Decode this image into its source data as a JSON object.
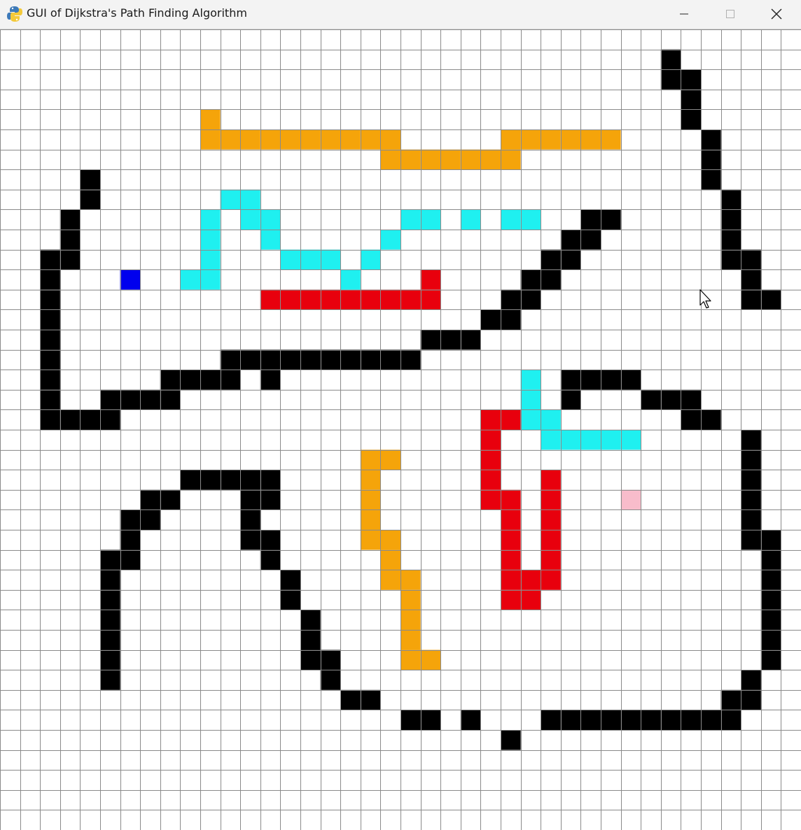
{
  "window": {
    "title": "GUI of Dijkstra's Path Finding Algorithm",
    "icon": "python-icon",
    "controls": [
      "minimize-icon",
      "maximize-icon",
      "close-icon"
    ]
  },
  "grid": {
    "rows": 40,
    "cols": 40,
    "line_color": "#8a8a8a",
    "empty_color": "#ffffff",
    "colors": {
      "barrier": "#000000",
      "start": "#0000ee",
      "end": "#f8bccb",
      "path": "#e8000d",
      "visited": "#f5a40a",
      "frontier": "#1ff0f0"
    },
    "cells": {
      "barrier": [
        [
          33,
          1
        ],
        [
          33,
          2
        ],
        [
          34,
          2
        ],
        [
          34,
          3
        ],
        [
          34,
          4
        ],
        [
          35,
          5
        ],
        [
          35,
          6
        ],
        [
          35,
          7
        ],
        [
          36,
          8
        ],
        [
          36,
          9
        ],
        [
          36,
          10
        ],
        [
          36,
          11
        ],
        [
          37,
          11
        ],
        [
          37,
          12
        ],
        [
          37,
          13
        ],
        [
          38,
          13
        ],
        [
          4,
          7
        ],
        [
          4,
          8
        ],
        [
          3,
          9
        ],
        [
          3,
          10
        ],
        [
          3,
          11
        ],
        [
          2,
          11
        ],
        [
          2,
          12
        ],
        [
          2,
          13
        ],
        [
          2,
          14
        ],
        [
          2,
          15
        ],
        [
          2,
          16
        ],
        [
          2,
          17
        ],
        [
          2,
          18
        ],
        [
          2,
          19
        ],
        [
          3,
          19
        ],
        [
          4,
          19
        ],
        [
          5,
          19
        ],
        [
          5,
          18
        ],
        [
          6,
          18
        ],
        [
          7,
          18
        ],
        [
          8,
          18
        ],
        [
          8,
          17
        ],
        [
          9,
          17
        ],
        [
          10,
          17
        ],
        [
          11,
          17
        ],
        [
          11,
          16
        ],
        [
          12,
          16
        ],
        [
          13,
          17
        ],
        [
          13,
          16
        ],
        [
          14,
          16
        ],
        [
          15,
          16
        ],
        [
          16,
          16
        ],
        [
          17,
          16
        ],
        [
          18,
          16
        ],
        [
          19,
          16
        ],
        [
          20,
          16
        ],
        [
          21,
          15
        ],
        [
          22,
          15
        ],
        [
          23,
          15
        ],
        [
          24,
          14
        ],
        [
          25,
          14
        ],
        [
          25,
          13
        ],
        [
          26,
          13
        ],
        [
          26,
          12
        ],
        [
          27,
          12
        ],
        [
          27,
          11
        ],
        [
          28,
          11
        ],
        [
          28,
          10
        ],
        [
          29,
          10
        ],
        [
          29,
          9
        ],
        [
          30,
          9
        ],
        [
          28,
          17
        ],
        [
          29,
          17
        ],
        [
          30,
          17
        ],
        [
          31,
          17
        ],
        [
          28,
          18
        ],
        [
          32,
          18
        ],
        [
          33,
          18
        ],
        [
          34,
          18
        ],
        [
          34,
          19
        ],
        [
          35,
          19
        ],
        [
          37,
          20
        ],
        [
          37,
          21
        ],
        [
          37,
          22
        ],
        [
          37,
          23
        ],
        [
          37,
          24
        ],
        [
          37,
          25
        ],
        [
          38,
          25
        ],
        [
          38,
          26
        ],
        [
          38,
          27
        ],
        [
          38,
          28
        ],
        [
          38,
          29
        ],
        [
          38,
          30
        ],
        [
          38,
          31
        ],
        [
          37,
          32
        ],
        [
          37,
          33
        ],
        [
          36,
          33
        ],
        [
          36,
          34
        ],
        [
          35,
          34
        ],
        [
          34,
          34
        ],
        [
          33,
          34
        ],
        [
          32,
          34
        ],
        [
          31,
          34
        ],
        [
          30,
          34
        ],
        [
          29,
          34
        ],
        [
          28,
          34
        ],
        [
          27,
          34
        ],
        [
          25,
          35
        ],
        [
          23,
          34
        ],
        [
          21,
          34
        ],
        [
          20,
          34
        ],
        [
          18,
          33
        ],
        [
          17,
          33
        ],
        [
          16,
          32
        ],
        [
          16,
          31
        ],
        [
          15,
          31
        ],
        [
          15,
          30
        ],
        [
          15,
          29
        ],
        [
          14,
          28
        ],
        [
          14,
          27
        ],
        [
          13,
          26
        ],
        [
          13,
          25
        ],
        [
          12,
          25
        ],
        [
          12,
          24
        ],
        [
          12,
          23
        ],
        [
          12,
          22
        ],
        [
          13,
          22
        ],
        [
          13,
          23
        ],
        [
          11,
          22
        ],
        [
          10,
          22
        ],
        [
          9,
          22
        ],
        [
          8,
          23
        ],
        [
          7,
          23
        ],
        [
          7,
          24
        ],
        [
          6,
          24
        ],
        [
          6,
          25
        ],
        [
          6,
          26
        ],
        [
          5,
          26
        ],
        [
          5,
          27
        ],
        [
          5,
          28
        ],
        [
          5,
          29
        ],
        [
          5,
          30
        ],
        [
          5,
          31
        ],
        [
          5,
          32
        ]
      ],
      "start": [
        [
          6,
          12
        ]
      ],
      "end": [
        [
          31,
          23
        ]
      ],
      "path": [
        [
          13,
          13
        ],
        [
          14,
          13
        ],
        [
          15,
          13
        ],
        [
          16,
          13
        ],
        [
          17,
          13
        ],
        [
          18,
          13
        ],
        [
          19,
          13
        ],
        [
          20,
          13
        ],
        [
          21,
          13
        ],
        [
          21,
          12
        ],
        [
          24,
          19
        ],
        [
          25,
          19
        ],
        [
          24,
          20
        ],
        [
          24,
          21
        ],
        [
          24,
          22
        ],
        [
          24,
          23
        ],
        [
          25,
          23
        ],
        [
          25,
          24
        ],
        [
          25,
          25
        ],
        [
          25,
          26
        ],
        [
          25,
          27
        ],
        [
          25,
          28
        ],
        [
          26,
          28
        ],
        [
          27,
          22
        ],
        [
          27,
          23
        ],
        [
          27,
          24
        ],
        [
          27,
          25
        ],
        [
          27,
          26
        ],
        [
          27,
          27
        ],
        [
          26,
          27
        ]
      ],
      "visited": [
        [
          10,
          4
        ],
        [
          10,
          5
        ],
        [
          11,
          5
        ],
        [
          12,
          5
        ],
        [
          13,
          5
        ],
        [
          14,
          5
        ],
        [
          15,
          5
        ],
        [
          16,
          5
        ],
        [
          17,
          5
        ],
        [
          18,
          5
        ],
        [
          19,
          5
        ],
        [
          19,
          6
        ],
        [
          20,
          6
        ],
        [
          21,
          6
        ],
        [
          22,
          6
        ],
        [
          23,
          6
        ],
        [
          24,
          6
        ],
        [
          25,
          6
        ],
        [
          25,
          5
        ],
        [
          26,
          5
        ],
        [
          27,
          5
        ],
        [
          28,
          5
        ],
        [
          29,
          5
        ],
        [
          30,
          5
        ],
        [
          18,
          21
        ],
        [
          19,
          21
        ],
        [
          18,
          22
        ],
        [
          18,
          23
        ],
        [
          18,
          24
        ],
        [
          18,
          25
        ],
        [
          19,
          25
        ],
        [
          19,
          26
        ],
        [
          19,
          27
        ],
        [
          20,
          27
        ],
        [
          20,
          28
        ],
        [
          20,
          29
        ],
        [
          20,
          30
        ],
        [
          20,
          31
        ],
        [
          21,
          31
        ]
      ],
      "frontier": [
        [
          11,
          8
        ],
        [
          12,
          8
        ],
        [
          10,
          9
        ],
        [
          12,
          9
        ],
        [
          13,
          9
        ],
        [
          10,
          10
        ],
        [
          13,
          10
        ],
        [
          10,
          11
        ],
        [
          14,
          11
        ],
        [
          15,
          11
        ],
        [
          16,
          11
        ],
        [
          18,
          11
        ],
        [
          9,
          12
        ],
        [
          10,
          12
        ],
        [
          17,
          12
        ],
        [
          19,
          10
        ],
        [
          20,
          9
        ],
        [
          21,
          9
        ],
        [
          23,
          9
        ],
        [
          25,
          9
        ],
        [
          26,
          9
        ],
        [
          26,
          17
        ],
        [
          26,
          18
        ],
        [
          26,
          19
        ],
        [
          27,
          19
        ],
        [
          27,
          20
        ],
        [
          28,
          20
        ],
        [
          29,
          20
        ],
        [
          30,
          20
        ],
        [
          31,
          20
        ]
      ]
    }
  },
  "cursor": {
    "icon": "mouse-pointer-icon"
  }
}
